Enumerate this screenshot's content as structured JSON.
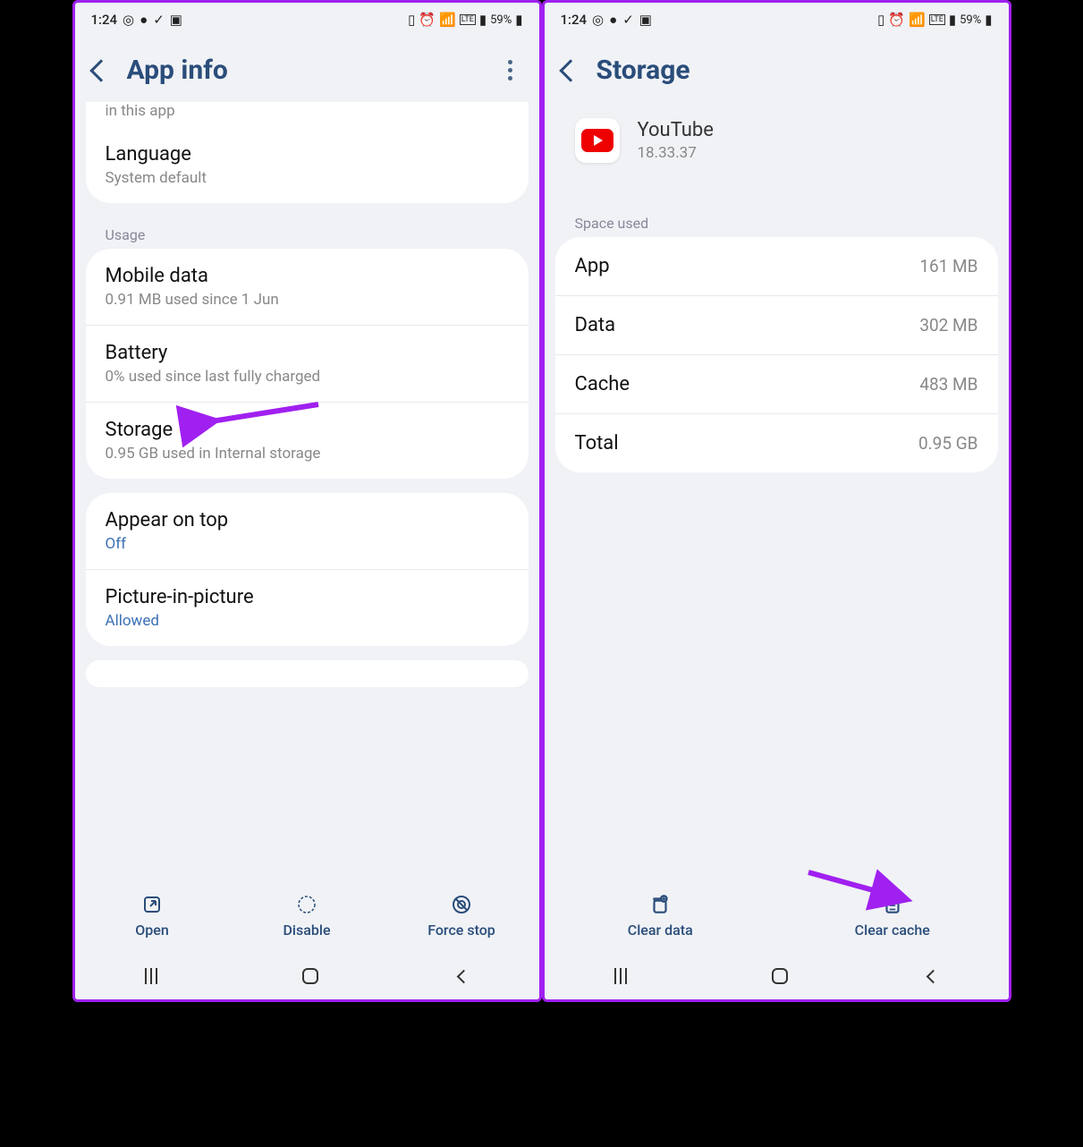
{
  "status": {
    "time": "1:24",
    "battery_text": "59%"
  },
  "left": {
    "title": "App info",
    "overflow_text": "in this app",
    "language_item": {
      "title": "Language",
      "sub": "System default"
    },
    "usage_label": "Usage",
    "mobile_data": {
      "title": "Mobile data",
      "sub": "0.91 MB used since 1 Jun"
    },
    "battery": {
      "title": "Battery",
      "sub": "0% used since last fully charged"
    },
    "storage": {
      "title": "Storage",
      "sub": "0.95 GB used in Internal storage"
    },
    "appear_on_top": {
      "title": "Appear on top",
      "sub": "Off"
    },
    "pip": {
      "title": "Picture-in-picture",
      "sub": "Allowed"
    },
    "actions": {
      "open": "Open",
      "disable": "Disable",
      "force_stop": "Force stop"
    }
  },
  "right": {
    "title": "Storage",
    "app_name": "YouTube",
    "app_version": "18.33.37",
    "space_label": "Space used",
    "rows": {
      "app": {
        "label": "App",
        "value": "161 MB"
      },
      "data": {
        "label": "Data",
        "value": "302 MB"
      },
      "cache": {
        "label": "Cache",
        "value": "483 MB"
      },
      "total": {
        "label": "Total",
        "value": "0.95 GB"
      }
    },
    "actions": {
      "clear_data": "Clear data",
      "clear_cache": "Clear cache"
    }
  }
}
